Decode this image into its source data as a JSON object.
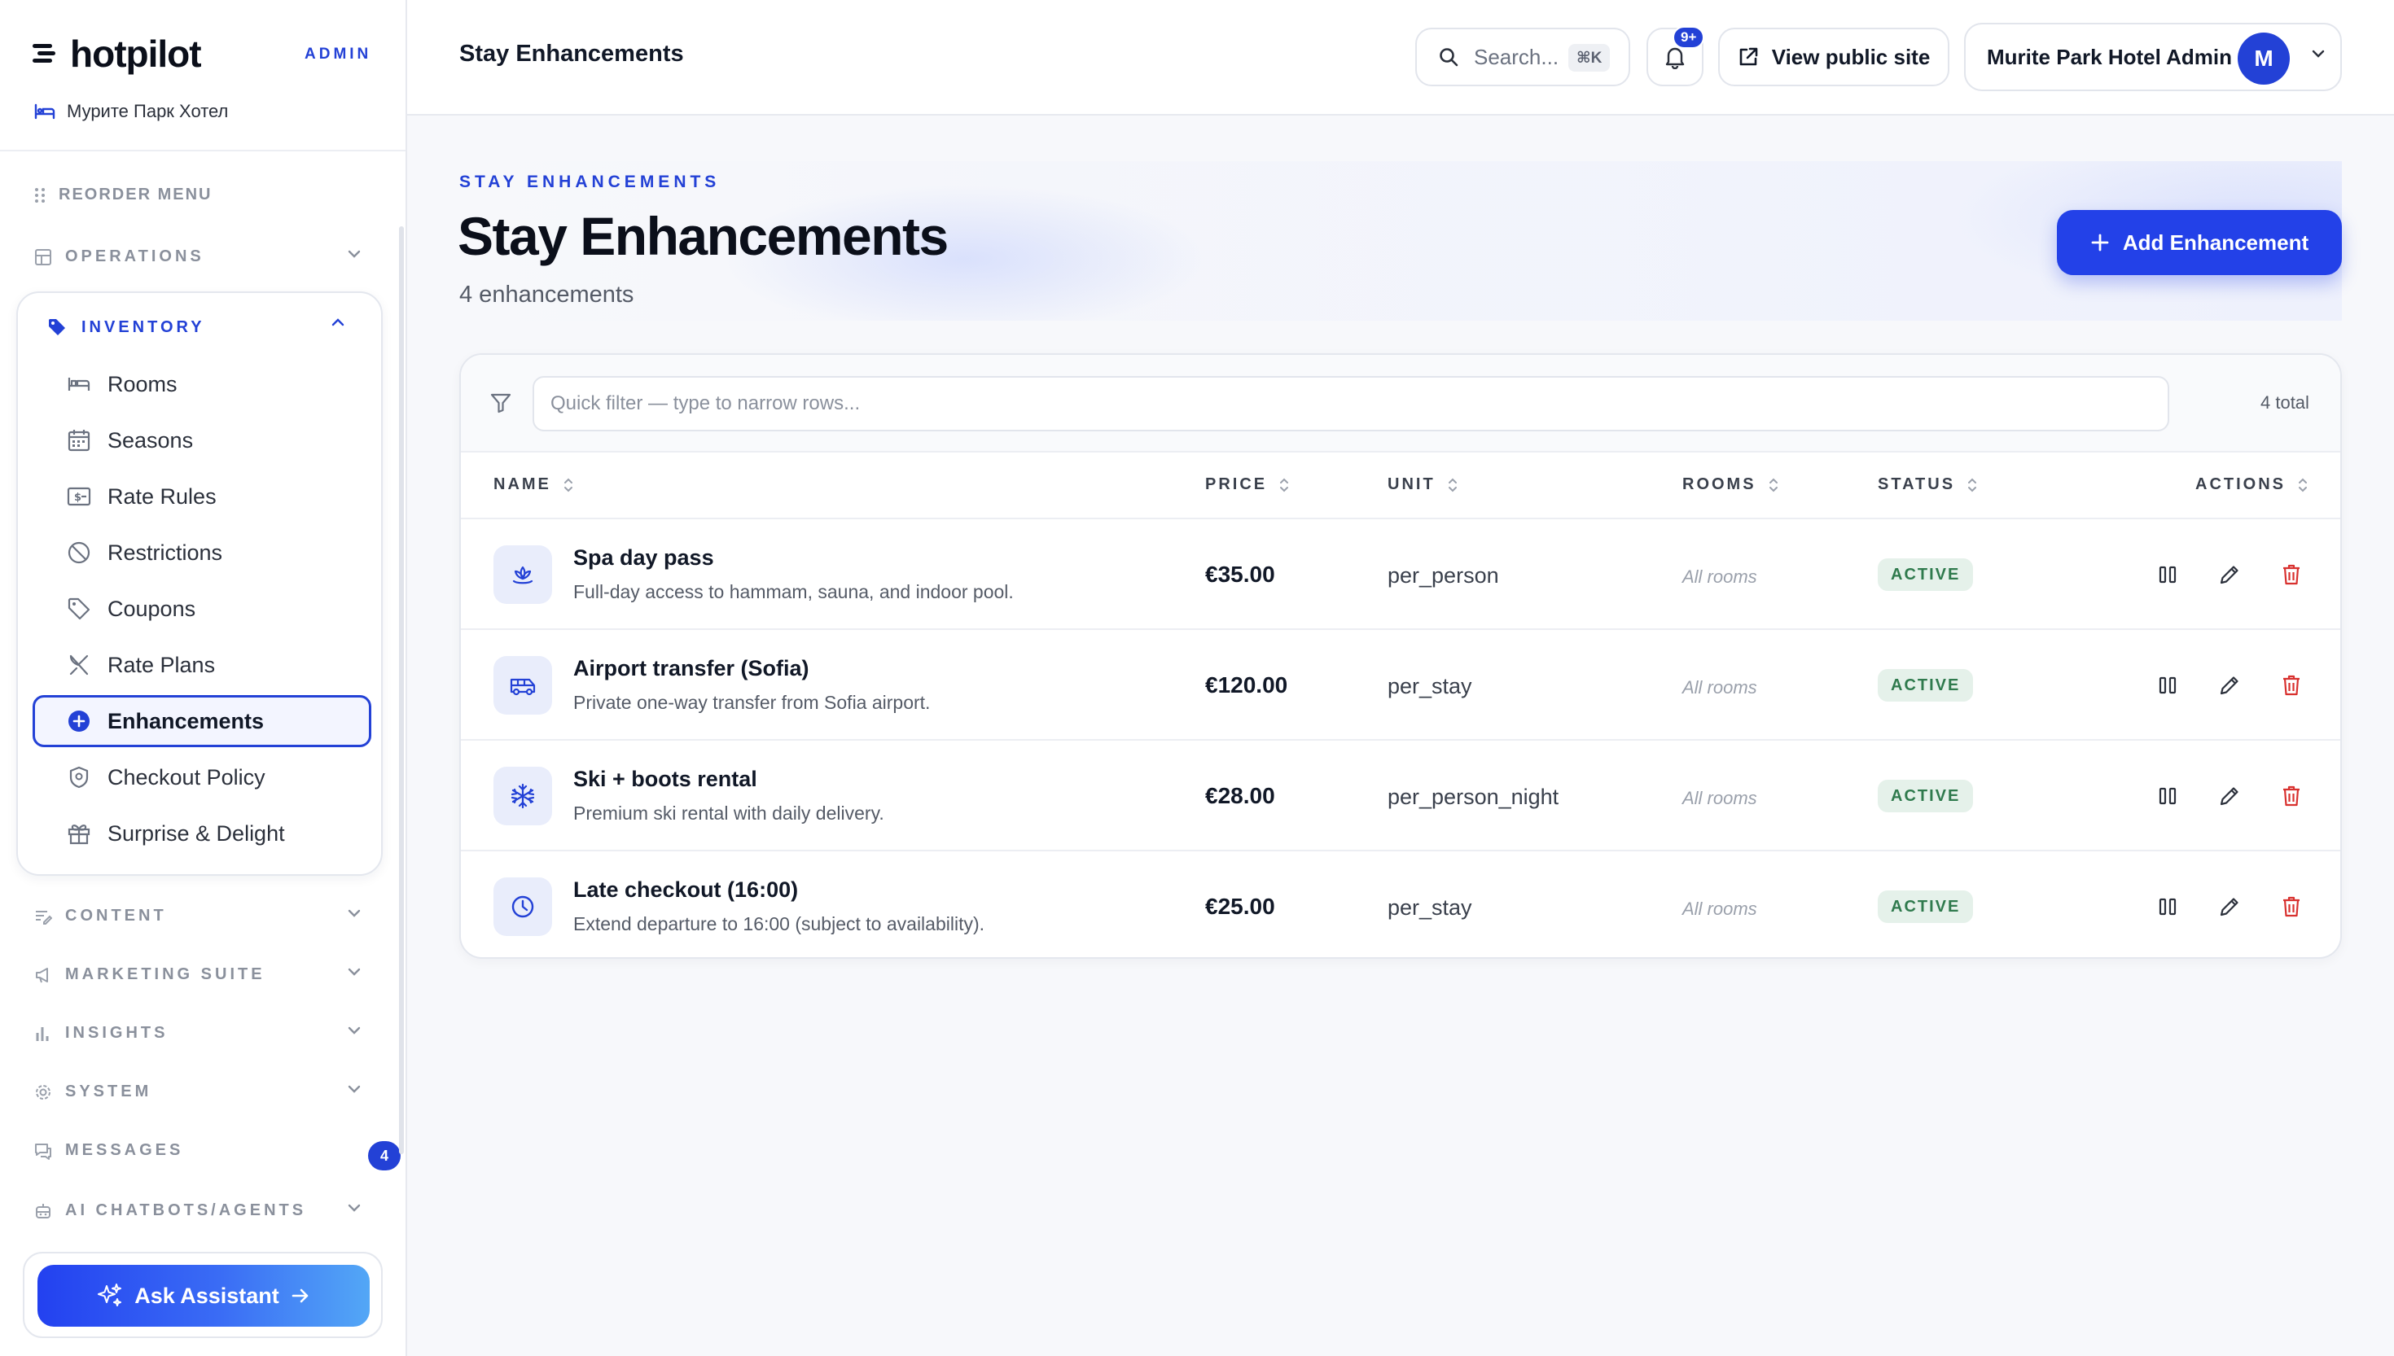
{
  "brand": {
    "name": "hotpilot",
    "tag": "ADMIN",
    "hotel": "Мурите Парк Хотел"
  },
  "sidebar": {
    "reorder": "REORDER MENU",
    "operations": "OPERATIONS",
    "inventory": {
      "label": "INVENTORY",
      "items": [
        {
          "label": "Rooms",
          "icon": "bed-icon"
        },
        {
          "label": "Seasons",
          "icon": "calendar-icon"
        },
        {
          "label": "Rate Rules",
          "icon": "money-icon"
        },
        {
          "label": "Restrictions",
          "icon": "ban-icon"
        },
        {
          "label": "Coupons",
          "icon": "tag-icon"
        },
        {
          "label": "Rate Plans",
          "icon": "utensils-icon"
        },
        {
          "label": "Enhancements",
          "icon": "plus-circle-icon",
          "active": true
        },
        {
          "label": "Checkout Policy",
          "icon": "shield-icon"
        },
        {
          "label": "Surprise & Delight",
          "icon": "gift-icon"
        }
      ]
    },
    "sections": {
      "content": "CONTENT",
      "marketing": "MARKETING SUITE",
      "insights": "INSIGHTS",
      "system": "SYSTEM",
      "messages": "MESSAGES",
      "messages_badge": "4",
      "ai": "AI CHATBOTS/AGENTS"
    },
    "ask_assistant": "Ask Assistant"
  },
  "topbar": {
    "title": "Stay Enhancements",
    "search_placeholder": "Search...",
    "search_shortcut": "⌘K",
    "notif_badge": "9+",
    "view_public": "View public site",
    "account": "Murite Park Hotel Admin",
    "avatar_initial": "M"
  },
  "hero": {
    "eyebrow": "STAY ENHANCEMENTS",
    "title": "Stay Enhancements",
    "subtitle": "4 enhancements",
    "add_button": "Add Enhancement"
  },
  "table": {
    "filter_placeholder": "Quick filter — type to narrow rows...",
    "total": "4 total",
    "columns": {
      "name": "NAME",
      "price": "PRICE",
      "unit": "UNIT",
      "rooms": "ROOMS",
      "status": "STATUS",
      "actions": "ACTIONS"
    },
    "rows": [
      {
        "icon": "spa-icon",
        "name": "Spa day pass",
        "desc": "Full-day access to hammam, sauna, and indoor pool.",
        "price": "€35.00",
        "unit": "per_person",
        "rooms": "All rooms",
        "status": "ACTIVE"
      },
      {
        "icon": "shuttle-icon",
        "name": "Airport transfer (Sofia)",
        "desc": "Private one-way transfer from Sofia airport.",
        "price": "€120.00",
        "unit": "per_stay",
        "rooms": "All rooms",
        "status": "ACTIVE"
      },
      {
        "icon": "snowflake-icon",
        "name": "Ski + boots rental",
        "desc": "Premium ski rental with daily delivery.",
        "price": "€28.00",
        "unit": "per_person_night",
        "rooms": "All rooms",
        "status": "ACTIVE"
      },
      {
        "icon": "clock-icon",
        "name": "Late checkout (16:00)",
        "desc": "Extend departure to 16:00 (subject to availability).",
        "price": "€25.00",
        "unit": "per_stay",
        "rooms": "All rooms",
        "status": "ACTIVE"
      }
    ]
  },
  "colors": {
    "accent": "#2341d6",
    "active_bg": "#e5f1ea",
    "active_text": "#2f7a4d",
    "danger": "#d8312f"
  }
}
